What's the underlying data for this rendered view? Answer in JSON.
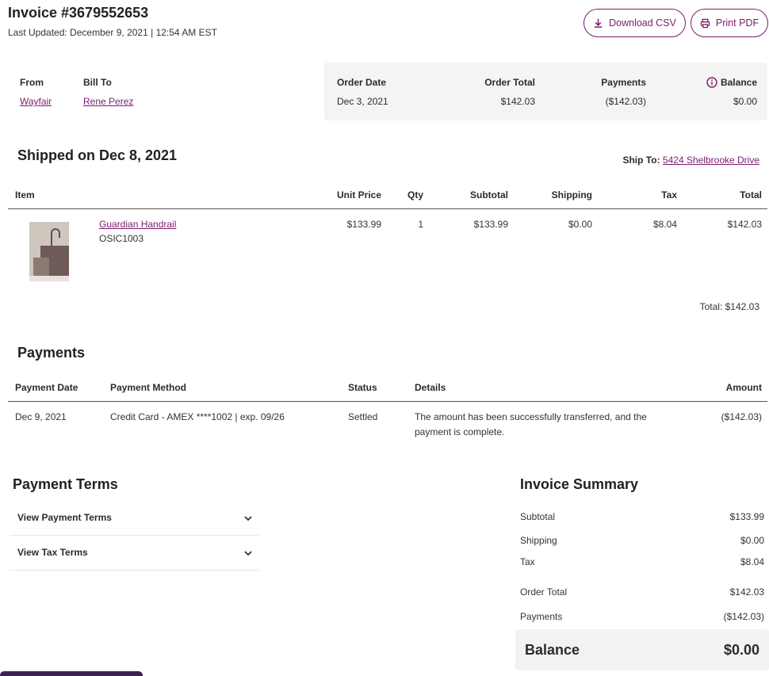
{
  "header": {
    "title": "Invoice #3679552653",
    "updated": "Last Updated: December 9, 2021 | 12:54 AM EST",
    "download_csv": "Download CSV",
    "print_pdf": "Print PDF"
  },
  "parties": {
    "from_label": "From",
    "from_value": "Wayfair",
    "bill_to_label": "Bill To",
    "bill_to_value": "Rene Perez"
  },
  "order_summary": {
    "order_date_label": "Order Date",
    "order_date": "Dec 3, 2021",
    "order_total_label": "Order Total",
    "order_total": "$142.03",
    "payments_label": "Payments",
    "payments": "($142.03)",
    "balance_label": "Balance",
    "balance": "$0.00"
  },
  "shipment": {
    "heading": "Shipped on Dec 8, 2021",
    "ship_to_label": "Ship To:",
    "ship_to_address": "5424 Shelbrooke Drive",
    "columns": [
      "Item",
      "Unit Price",
      "Qty",
      "Subtotal",
      "Shipping",
      "Tax",
      "Total"
    ],
    "item": {
      "name": "Guardian Handrail",
      "sku": "OSIC1003",
      "unit_price": "$133.99",
      "qty": "1",
      "subtotal": "$133.99",
      "shipping": "$0.00",
      "tax": "$8.04",
      "total": "$142.03"
    },
    "total_line": "Total: $142.03"
  },
  "payments": {
    "heading": "Payments",
    "columns": [
      "Payment Date",
      "Payment Method",
      "Status",
      "Details",
      "Amount"
    ],
    "row": {
      "date": "Dec 9, 2021",
      "method": "Credit Card - AMEX ****1002 | exp. 09/26",
      "status": "Settled",
      "details_1": "The amount has been successfully transferred, and the",
      "details_2": "payment is complete.",
      "amount": "($142.03)"
    }
  },
  "payment_terms": {
    "heading": "Payment Terms",
    "items": [
      "View Payment Terms",
      "View Tax Terms"
    ]
  },
  "invoice_summary": {
    "heading": "Invoice Summary",
    "subtotal_label": "Subtotal",
    "subtotal": "$133.99",
    "shipping_label": "Shipping",
    "shipping": "$0.00",
    "tax_label": "Tax",
    "tax": "$8.04",
    "order_total_label": "Order Total",
    "order_total": "$142.03",
    "payments_label": "Payments",
    "payments": "($142.03)",
    "balance_label": "Balance",
    "balance": "$0.00"
  },
  "colors": {
    "accent": "#7b1c6f",
    "panel": "#f4f4f4",
    "bottom_bar": "#3c2253"
  },
  "icons": {
    "download": "download-icon",
    "print": "print-icon",
    "info": "info-icon",
    "chevron": "chevron-down-icon"
  }
}
